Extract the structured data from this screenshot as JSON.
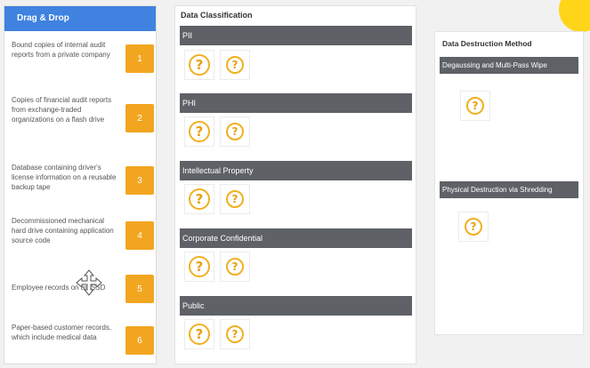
{
  "drag_drop": {
    "header": "Drag & Drop",
    "items": [
      {
        "text": "Bound copies of internal audit reports from a private company",
        "badge": "1"
      },
      {
        "text": "Copies of financial audit reports from exchange-traded organizations on a flash drive",
        "badge": "2"
      },
      {
        "text": "Database containing driver's license information on a reusable backup tape",
        "badge": "3"
      },
      {
        "text": "Decommissioned mechanical hard drive containing application source code",
        "badge": "4"
      },
      {
        "text": "Employee records on an SSD",
        "badge": "5"
      },
      {
        "text": "Paper-based customer records, which include medical data",
        "badge": "6"
      }
    ]
  },
  "classification": {
    "title": "Data Classification",
    "categories": [
      {
        "label": "PII"
      },
      {
        "label": "PHI"
      },
      {
        "label": "Intellectual Property"
      },
      {
        "label": "Corporate Confidential"
      },
      {
        "label": "Public"
      }
    ],
    "placeholder_glyph": "?"
  },
  "destruction": {
    "title": "Data Destruction Method",
    "methods": [
      {
        "label": "Degaussing and Multi-Pass Wipe"
      },
      {
        "label": "Physical Destruction via Shredding"
      }
    ]
  },
  "colors": {
    "header_blue": "#3f82e0",
    "badge_orange": "#f2a620",
    "bar_gray": "#5e6166",
    "question_gold": "#f0b020"
  },
  "icons": {
    "move": "move-arrows-icon",
    "placeholder": "question-mark-icon"
  }
}
